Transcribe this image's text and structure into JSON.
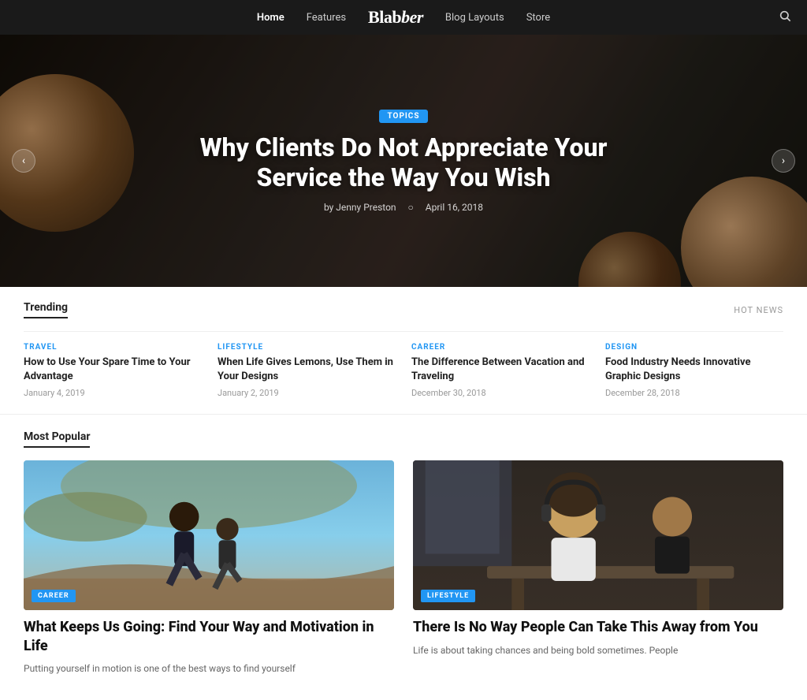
{
  "nav": {
    "brand": "Blab",
    "brand_accent": "ber",
    "links": [
      {
        "label": "Home",
        "active": true
      },
      {
        "label": "Features",
        "active": false
      },
      {
        "label": "Blog Layouts",
        "active": false
      },
      {
        "label": "Store",
        "active": false
      }
    ],
    "search_icon": "🔍"
  },
  "hero": {
    "badge": "TOPICS",
    "title": "Why Clients Do Not Appreciate Your Service the Way You Wish",
    "author": "by Jenny Preston",
    "date": "April 16, 2018",
    "arrow_left": "‹",
    "arrow_right": "›"
  },
  "trending": {
    "section_title": "Trending",
    "hot_news_label": "HOT NEWS",
    "items": [
      {
        "category": "TRAVEL",
        "category_class": "cat-travel",
        "title": "How to Use Your Spare Time to Your Advantage",
        "date": "January 4, 2019"
      },
      {
        "category": "LIFESTYLE",
        "category_class": "cat-lifestyle",
        "title": "When Life Gives Lemons, Use Them in Your Designs",
        "date": "January 2, 2019"
      },
      {
        "category": "CAREER",
        "category_class": "cat-career",
        "title": "The Difference Between Vacation and Traveling",
        "date": "December 30, 2018"
      },
      {
        "category": "DESIGN",
        "category_class": "cat-design",
        "title": "Food Industry Needs Innovative Graphic Designs",
        "date": "December 28, 2018"
      }
    ]
  },
  "popular": {
    "section_title": "Most Popular",
    "items": [
      {
        "badge": "CAREER",
        "img_class": "img-running",
        "title": "What Keeps Us Going: Find Your Way and Motivation in Life",
        "excerpt": "Putting yourself in motion is one of the best ways to find yourself"
      },
      {
        "badge": "LIFESTYLE",
        "img_class": "img-lifestyle",
        "title": "There Is No Way People Can Take This Away from You",
        "excerpt": "Life is about taking chances and being bold sometimes. People"
      }
    ]
  }
}
